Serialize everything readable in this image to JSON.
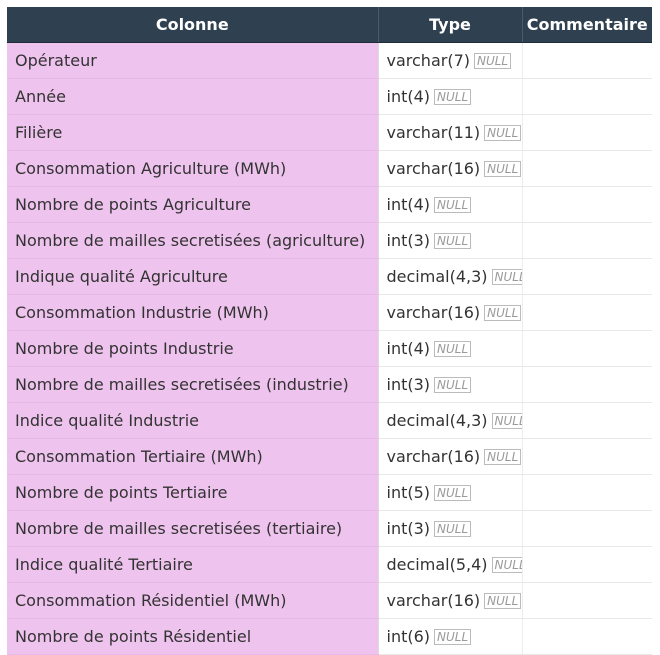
{
  "table": {
    "headers": {
      "column": "Colonne",
      "type": "Type",
      "comment": "Commentaire"
    },
    "null_label": "NULL",
    "rows": [
      {
        "name": "Opérateur",
        "type": "varchar(7)",
        "comment": ""
      },
      {
        "name": "Année",
        "type": "int(4)",
        "comment": ""
      },
      {
        "name": "Filière",
        "type": "varchar(11)",
        "comment": ""
      },
      {
        "name": "Consommation Agriculture (MWh)",
        "type": "varchar(16)",
        "comment": ""
      },
      {
        "name": "Nombre de points Agriculture",
        "type": "int(4)",
        "comment": ""
      },
      {
        "name": "Nombre de mailles secretisées (agriculture)",
        "type": "int(3)",
        "comment": ""
      },
      {
        "name": "Indique qualité Agriculture",
        "type": "decimal(4,3)",
        "comment": ""
      },
      {
        "name": "Consommation Industrie (MWh)",
        "type": "varchar(16)",
        "comment": ""
      },
      {
        "name": "Nombre de points Industrie",
        "type": "int(4)",
        "comment": ""
      },
      {
        "name": "Nombre de mailles secretisées (industrie)",
        "type": "int(3)",
        "comment": ""
      },
      {
        "name": "Indice qualité Industrie",
        "type": "decimal(4,3)",
        "comment": ""
      },
      {
        "name": "Consommation Tertiaire  (MWh)",
        "type": "varchar(16)",
        "comment": ""
      },
      {
        "name": "Nombre de points Tertiaire",
        "type": "int(5)",
        "comment": ""
      },
      {
        "name": "Nombre de mailles secretisées (tertiaire)",
        "type": "int(3)",
        "comment": ""
      },
      {
        "name": "Indice qualité Tertiaire",
        "type": "decimal(5,4)",
        "comment": ""
      },
      {
        "name": "Consommation Résidentiel  (MWh)",
        "type": "varchar(16)",
        "comment": ""
      },
      {
        "name": "Nombre de points Résidentiel",
        "type": "int(6)",
        "comment": ""
      }
    ]
  }
}
